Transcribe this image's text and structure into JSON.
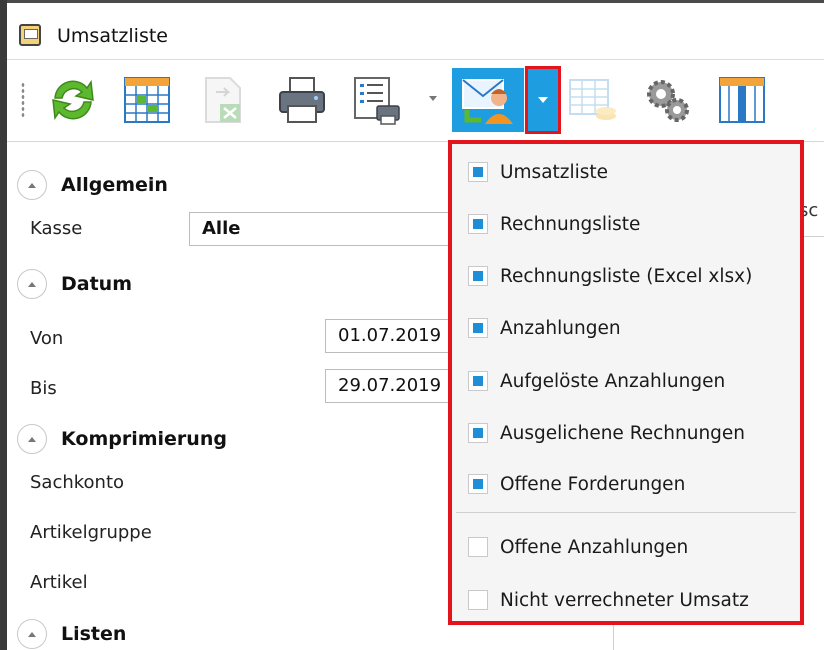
{
  "window": {
    "title": "Umsatzliste"
  },
  "toolbar": {
    "buttons": [
      {
        "icon": "refresh-icon"
      },
      {
        "icon": "calendar-grid-icon"
      },
      {
        "icon": "excel-export-icon"
      },
      {
        "icon": "printer-icon"
      },
      {
        "icon": "print-list-icon"
      },
      {
        "icon": "mail-person-icon"
      },
      {
        "icon": "table-coins-icon"
      },
      {
        "icon": "settings-gears-icon"
      },
      {
        "icon": "columns-icon"
      }
    ]
  },
  "panel": {
    "sections": {
      "allgemein": "Allgemein",
      "datum": "Datum",
      "komprimierung": "Komprimierung",
      "listen": "Listen"
    },
    "kasse": {
      "label": "Kasse",
      "value": "Alle"
    },
    "von": {
      "label": "Von",
      "value": "01.07.2019"
    },
    "bis": {
      "label": "Bis",
      "value": "29.07.2019"
    },
    "sachkonto": "Sachkonto",
    "artikelgruppe": "Artikelgruppe",
    "artikel": "Artikel",
    "right_tab": "sc"
  },
  "menu": {
    "items": [
      {
        "label": "Umsatzliste",
        "checked": true
      },
      {
        "label": "Rechnungsliste",
        "checked": true
      },
      {
        "label": "Rechnungsliste (Excel xlsx)",
        "checked": true
      },
      {
        "label": "Anzahlungen",
        "checked": true
      },
      {
        "label": "Aufgelöste Anzahlungen",
        "checked": true
      },
      {
        "label": "Ausgelichene Rechnungen",
        "checked": true
      },
      {
        "label": "Offene Forderungen",
        "checked": true
      },
      {
        "label": "Offene Anzahlungen",
        "checked": false
      },
      {
        "label": "Nicht verrechneter Umsatz",
        "checked": false
      }
    ]
  },
  "colors": {
    "accent": "#1e9ee0",
    "highlight": "#e3141c",
    "check": "#1e8fd6"
  }
}
